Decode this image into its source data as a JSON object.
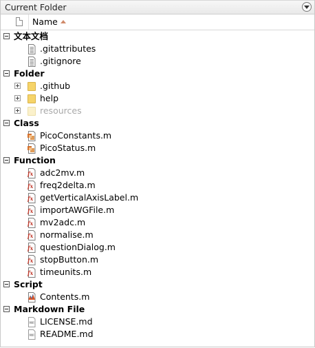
{
  "panel": {
    "title": "Current Folder"
  },
  "header": {
    "name_column": "Name"
  },
  "groups": [
    {
      "label": "文本文档",
      "items": [
        {
          "name": ".gitattributes",
          "icon": "text-file-icon"
        },
        {
          "name": ".gitignore",
          "icon": "text-file-icon"
        }
      ]
    },
    {
      "label": "Folder",
      "items": [
        {
          "name": ".github",
          "icon": "folder-icon"
        },
        {
          "name": "help",
          "icon": "folder-icon"
        },
        {
          "name": "resources",
          "icon": "folder-icon",
          "dimmed": true
        }
      ]
    },
    {
      "label": "Class",
      "items": [
        {
          "name": "PicoConstants.m",
          "icon": "class-file-icon"
        },
        {
          "name": "PicoStatus.m",
          "icon": "class-file-icon"
        }
      ]
    },
    {
      "label": "Function",
      "items": [
        {
          "name": "adc2mv.m",
          "icon": "function-file-icon"
        },
        {
          "name": "freq2delta.m",
          "icon": "function-file-icon"
        },
        {
          "name": "getVerticalAxisLabel.m",
          "icon": "function-file-icon"
        },
        {
          "name": "importAWGFile.m",
          "icon": "function-file-icon"
        },
        {
          "name": "mv2adc.m",
          "icon": "function-file-icon"
        },
        {
          "name": "normalise.m",
          "icon": "function-file-icon"
        },
        {
          "name": "questionDialog.m",
          "icon": "function-file-icon"
        },
        {
          "name": "stopButton.m",
          "icon": "function-file-icon"
        },
        {
          "name": "timeunits.m",
          "icon": "function-file-icon"
        }
      ]
    },
    {
      "label": "Script",
      "items": [
        {
          "name": "Contents.m",
          "icon": "script-file-icon"
        }
      ]
    },
    {
      "label": "Markdown File",
      "items": [
        {
          "name": "LICENSE.md",
          "icon": "markdown-file-icon"
        },
        {
          "name": "README.md",
          "icon": "markdown-file-icon"
        }
      ]
    }
  ]
}
